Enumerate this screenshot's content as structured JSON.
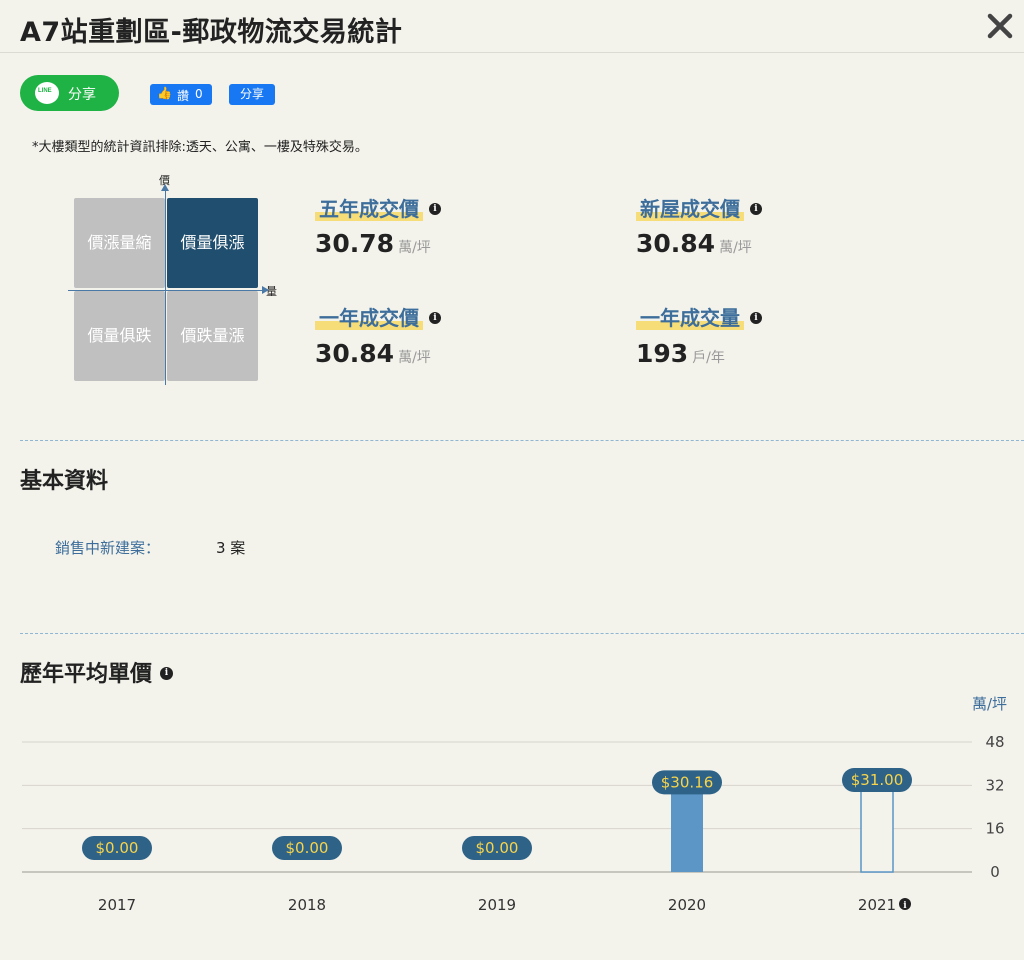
{
  "header": {
    "title": "A7站重劃區-郵政物流交易統計"
  },
  "share": {
    "line_logo": "LINE",
    "line_label": "分享",
    "fb_like_label": "讚",
    "fb_like_count": "0",
    "fb_share_label": "分享"
  },
  "note": "*大樓類型的統計資訊排除:透天、公寓、一樓及特殊交易。",
  "quadrant": {
    "price_axis": "價",
    "volume_axis": "量",
    "top_left": "價漲量縮",
    "top_right": "價量俱漲",
    "bottom_left": "價量俱跌",
    "bottom_right": "價跌量漲",
    "active": "top_right"
  },
  "stats": {
    "five_year": {
      "title": "五年成交價",
      "value": "30.78",
      "unit": "萬/坪"
    },
    "new_house": {
      "title": "新屋成交價",
      "value": "30.84",
      "unit": "萬/坪"
    },
    "one_year_price": {
      "title": "一年成交價",
      "value": "30.84",
      "unit": "萬/坪"
    },
    "one_year_volume": {
      "title": "一年成交量",
      "value": "193",
      "unit": "戶/年"
    }
  },
  "basic": {
    "title": "基本資料",
    "label": "銷售中新建案：",
    "value": "3 案"
  },
  "history": {
    "title": "歷年平均單價",
    "unit": "萬/坪"
  },
  "colors": {
    "accent": "#3d6e9b",
    "dark_blue": "#1f4e6f",
    "bar": "#5b96c6",
    "highlight": "#f7dd77",
    "label_bg": "#2e6287",
    "label_text": "#f7d44a"
  },
  "chart_data": {
    "type": "bar",
    "categories": [
      "2017",
      "2018",
      "2019",
      "2020",
      "2021"
    ],
    "values": [
      0,
      0,
      0,
      30.16,
      31.0
    ],
    "value_labels": [
      "$0.00",
      "$0.00",
      "$0.00",
      "$30.16",
      "$31.00"
    ],
    "y_ticks": [
      "0",
      "16",
      "32",
      "48"
    ],
    "ylim": [
      0,
      48
    ],
    "grid": true,
    "last_bar_style": "outline"
  }
}
